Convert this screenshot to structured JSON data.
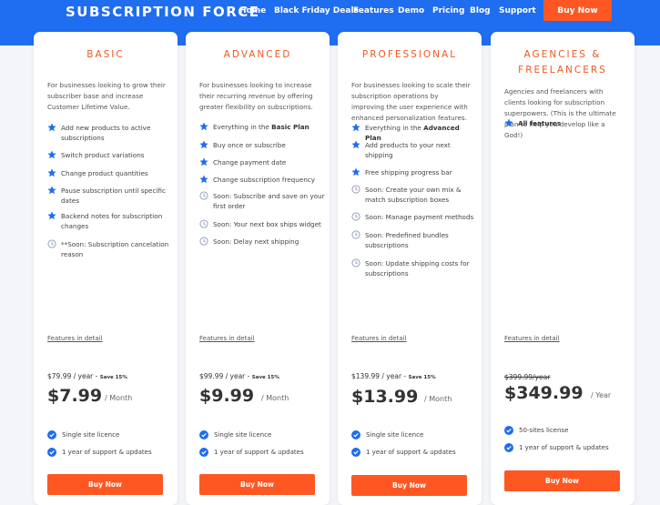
{
  "header": {
    "brand": "SUBSCRIPTION FORCE",
    "nav": [
      "Home",
      "Black Friday Deals",
      "Features",
      "Demo",
      "Pricing",
      "Blog",
      "Support"
    ],
    "buy_now": "Buy Now"
  },
  "colors": {
    "primary": "#1f6df0",
    "accent": "#ff5722",
    "plan_title": "#ee5a24"
  },
  "plans": [
    {
      "name_lines": [
        "BASIC"
      ],
      "description": "For businesses looking to grow their subscriber base and increase Customer Lifetime Value.",
      "features": [
        {
          "icon": "star-icon",
          "text": "Add new products to active subscriptions"
        },
        {
          "icon": "star-icon",
          "text": "Switch product variations"
        },
        {
          "icon": "star-icon",
          "text": "Change product quantities"
        },
        {
          "icon": "star-icon",
          "text": "Pause subscription until specific dates"
        },
        {
          "icon": "star-icon",
          "text": "Backend notes for subscription changes"
        },
        {
          "icon": "clock-icon",
          "text": "**Soon: Subscription cancelation reason"
        }
      ],
      "features_link": "Features in detail",
      "yearly": "$79.99 / year",
      "save": "Save 15%",
      "price": "$7.99",
      "period": "/ Month",
      "licence": [
        "Single site licence",
        "1 year of support & updates"
      ],
      "buy": "Buy Now"
    },
    {
      "name_lines": [
        "ADVANCED"
      ],
      "description": "For businesses looking to increase their recurring revenue by offering greater flexibility on subscriptions.",
      "features": [
        {
          "icon": "star-icon",
          "text": "Everything in the ",
          "bold": "Basic Plan"
        },
        {
          "icon": "star-icon",
          "text": "Buy once or subscribe"
        },
        {
          "icon": "star-icon",
          "text": "Change payment date"
        },
        {
          "icon": "star-icon",
          "text": "Change subscription frequency"
        },
        {
          "icon": "clock-icon",
          "text": "Soon: Subscribe and save on your first order"
        },
        {
          "icon": "clock-icon",
          "text": "Soon: Your next box ships widget"
        },
        {
          "icon": "clock-icon",
          "text": "Soon: Delay next shipping"
        }
      ],
      "features_link": "Features in detail",
      "yearly": "$99.99 / year",
      "save": "Save 15%",
      "price": "$9.99",
      "period": "/ Month",
      "licence": [
        "Single site licence",
        "1 year of support & updates"
      ],
      "buy": "Buy Now"
    },
    {
      "name_lines": [
        "PROFESSIONAL"
      ],
      "description": "For businesses looking to scale their subscription operations by improving the user experience with enhanced personalization features.",
      "features": [
        {
          "icon": "star-icon",
          "text": "Everything in the ",
          "bold": "Advanced Plan"
        },
        {
          "icon": "star-icon",
          "text": "Add products to your next shipping"
        },
        {
          "icon": "star-icon",
          "text": "Free shipping progress bar"
        },
        {
          "icon": "clock-icon",
          "text": "Soon: Create your own mix & match subscription boxes"
        },
        {
          "icon": "clock-icon",
          "text": "Soon: Manage payment methods"
        },
        {
          "icon": "clock-icon",
          "text": "Soon: Predefined bundles subscriptions"
        },
        {
          "icon": "clock-icon",
          "text": "Soon: Update shipping costs for subscriptions"
        }
      ],
      "features_link": "Features in detail",
      "yearly": "$139.99 / year",
      "save": "Save 15%",
      "price": "$13.99",
      "period": "/ Month",
      "licence": [
        "Single site licence",
        "1 year of support & updates"
      ],
      "buy": "Buy Now"
    },
    {
      "name_lines": [
        "AGENCIES &",
        "FREELANCERS"
      ],
      "description": "Agencies and freelancers with clients looking for subscription superpowers. (This is the ultimate plan to help you develop like a God!)",
      "features": [
        {
          "icon": "star-icon",
          "text": "",
          "bold": "All features"
        }
      ],
      "features_link": "Features in detail",
      "yearly": "$399.99/year",
      "price": "$349.99",
      "period": "/ Year",
      "licence": [
        "50-sites license",
        "1 year of support & updates"
      ],
      "buy": "Buy Now"
    }
  ]
}
